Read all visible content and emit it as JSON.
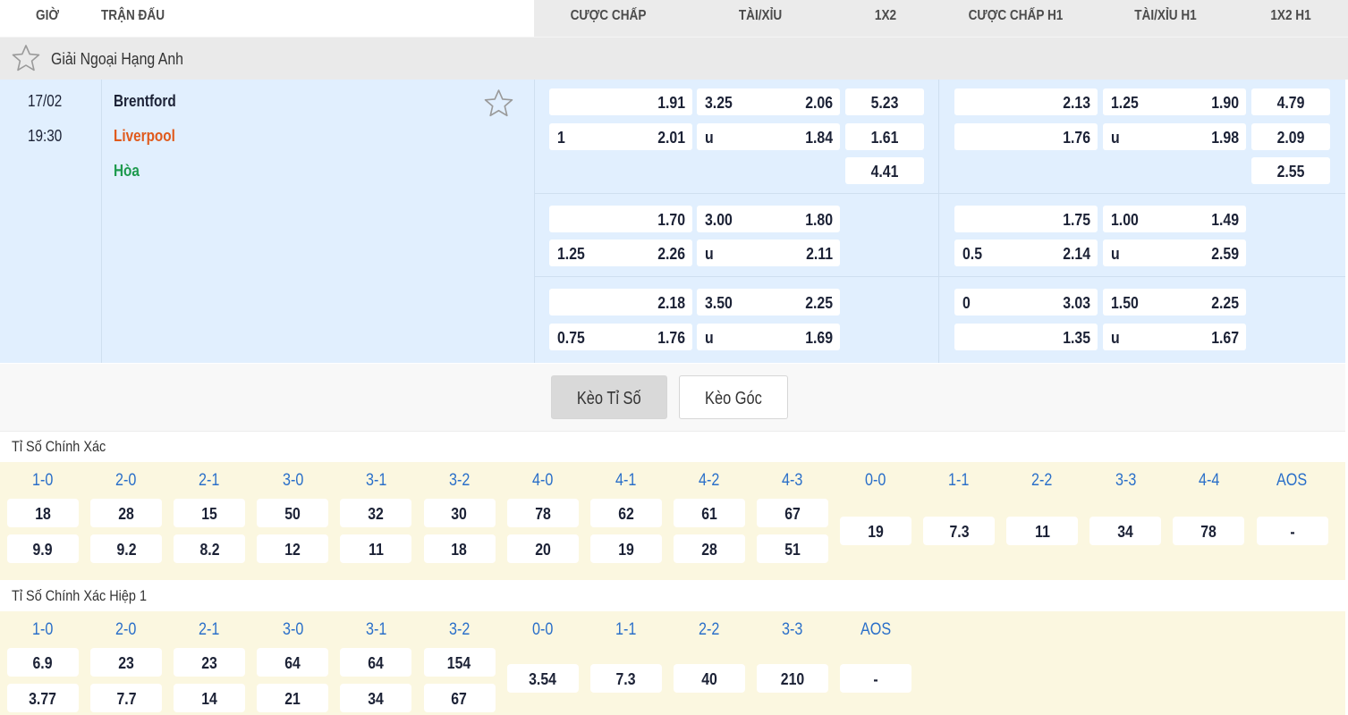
{
  "header": {
    "col_time": "GIỜ",
    "col_match": "TRẬN ĐẤU",
    "col_handicap": "CƯỢC CHẤP",
    "col_ou": "TÀI/XỈU",
    "col_1x2": "1X2",
    "col_handicap_h1": "CƯỢC CHẤP H1",
    "col_ou_h1": "TÀI/XỈU H1",
    "col_1x2_h1": "1X2 H1"
  },
  "league": {
    "name": "Giải Ngoại Hạng Anh",
    "icon": "star-outline-icon"
  },
  "match": {
    "date": "17/02",
    "time": "19:30",
    "home": "Brentford",
    "away": "Liverpool",
    "draw": "Hòa",
    "home_color": "#1c2236",
    "away_color": "#e05a1c",
    "draw_color": "#1e9a4e",
    "favorite_icon": "star-outline-icon",
    "odds_groups": [
      {
        "handicap": [
          {
            "line": "",
            "odds": "1.91"
          },
          {
            "line": "1",
            "odds": "2.01"
          }
        ],
        "ou": [
          {
            "line": "3.25",
            "odds": "2.06"
          },
          {
            "line": "u",
            "odds": "1.84"
          }
        ],
        "x12": [
          "5.23",
          "1.61",
          "4.41"
        ],
        "handicap_h1": [
          {
            "line": "",
            "odds": "2.13"
          },
          {
            "line": "",
            "odds": "1.76"
          }
        ],
        "ou_h1": [
          {
            "line": "1.25",
            "odds": "1.90"
          },
          {
            "line": "u",
            "odds": "1.98"
          }
        ],
        "x12_h1": [
          "4.79",
          "2.09",
          "2.55"
        ]
      },
      {
        "handicap": [
          {
            "line": "",
            "odds": "1.70"
          },
          {
            "line": "1.25",
            "odds": "2.26"
          }
        ],
        "ou": [
          {
            "line": "3.00",
            "odds": "1.80"
          },
          {
            "line": "u",
            "odds": "2.11"
          }
        ],
        "handicap_h1": [
          {
            "line": "",
            "odds": "1.75"
          },
          {
            "line": "0.5",
            "odds": "2.14"
          }
        ],
        "ou_h1": [
          {
            "line": "1.00",
            "odds": "1.49"
          },
          {
            "line": "u",
            "odds": "2.59"
          }
        ]
      },
      {
        "handicap": [
          {
            "line": "",
            "odds": "2.18"
          },
          {
            "line": "0.75",
            "odds": "1.76"
          }
        ],
        "ou": [
          {
            "line": "3.50",
            "odds": "2.25"
          },
          {
            "line": "u",
            "odds": "1.69"
          }
        ],
        "handicap_h1": [
          {
            "line": "0",
            "odds": "3.03"
          },
          {
            "line": "",
            "odds": "1.35"
          }
        ],
        "ou_h1": [
          {
            "line": "1.50",
            "odds": "2.25"
          },
          {
            "line": "u",
            "odds": "1.67"
          }
        ]
      }
    ]
  },
  "tabs": [
    {
      "label": "Kèo Tỉ Số",
      "active": true
    },
    {
      "label": "Kèo Góc",
      "active": false
    }
  ],
  "correct_score": {
    "title": "Tỉ Số Chính Xác",
    "paired": [
      {
        "score": "1-0",
        "home": "18",
        "away": "9.9"
      },
      {
        "score": "2-0",
        "home": "28",
        "away": "9.2"
      },
      {
        "score": "2-1",
        "home": "15",
        "away": "8.2"
      },
      {
        "score": "3-0",
        "home": "50",
        "away": "12"
      },
      {
        "score": "3-1",
        "home": "32",
        "away": "11"
      },
      {
        "score": "3-2",
        "home": "30",
        "away": "18"
      },
      {
        "score": "4-0",
        "home": "78",
        "away": "20"
      },
      {
        "score": "4-1",
        "home": "62",
        "away": "19"
      },
      {
        "score": "4-2",
        "home": "61",
        "away": "28"
      },
      {
        "score": "4-3",
        "home": "67",
        "away": "51"
      }
    ],
    "single": [
      {
        "score": "0-0",
        "odds": "19"
      },
      {
        "score": "1-1",
        "odds": "7.3"
      },
      {
        "score": "2-2",
        "odds": "11"
      },
      {
        "score": "3-3",
        "odds": "34"
      },
      {
        "score": "4-4",
        "odds": "78"
      },
      {
        "score": "AOS",
        "odds": "-"
      }
    ]
  },
  "correct_score_h1": {
    "title": "Tỉ Số Chính Xác Hiệp 1",
    "paired": [
      {
        "score": "1-0",
        "home": "6.9",
        "away": "3.77"
      },
      {
        "score": "2-0",
        "home": "23",
        "away": "7.7"
      },
      {
        "score": "2-1",
        "home": "23",
        "away": "14"
      },
      {
        "score": "3-0",
        "home": "64",
        "away": "21"
      },
      {
        "score": "3-1",
        "home": "64",
        "away": "34"
      },
      {
        "score": "3-2",
        "home": "154",
        "away": "67"
      }
    ],
    "single": [
      {
        "score": "0-0",
        "odds": "3.54"
      },
      {
        "score": "1-1",
        "odds": "7.3"
      },
      {
        "score": "2-2",
        "odds": "40"
      },
      {
        "score": "3-3",
        "odds": "210"
      },
      {
        "score": "AOS",
        "odds": "-"
      }
    ]
  },
  "colors": {
    "score_label": "#2a6fc9",
    "match_bg": "#e1effe",
    "score_bg": "#fbf7e0",
    "active_tab_bg": "#d9d9d9"
  }
}
